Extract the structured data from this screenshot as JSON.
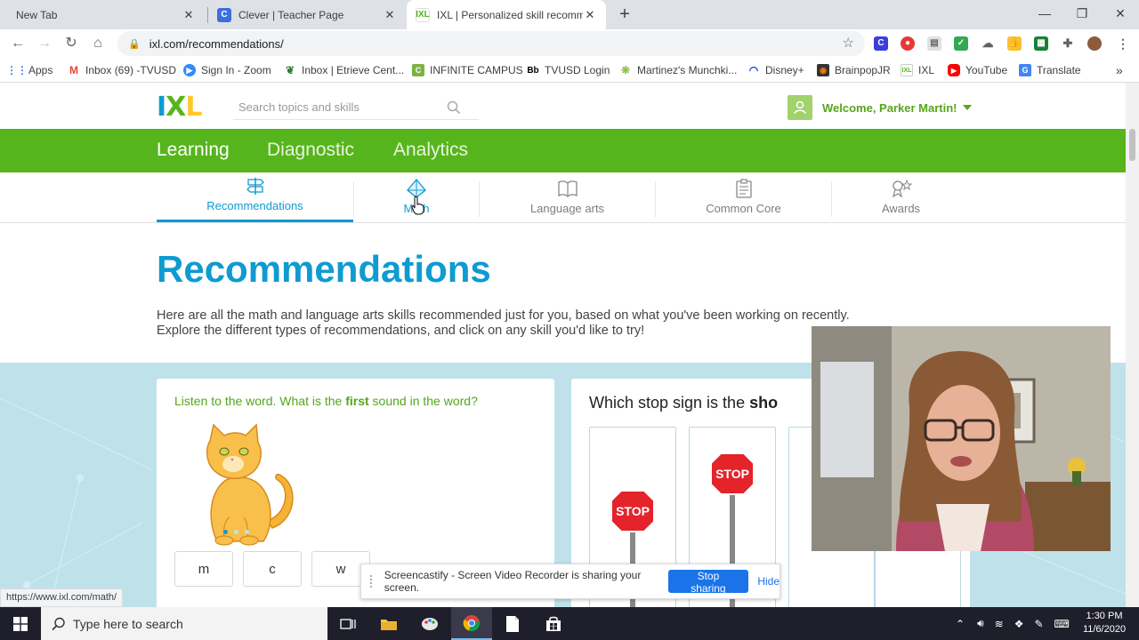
{
  "browser": {
    "tabs": [
      {
        "title": "New Tab"
      },
      {
        "title": "Clever | Teacher Page"
      },
      {
        "title": "IXL | Personalized skill recommen",
        "active": true
      }
    ],
    "url": "ixl.com/recommendations/",
    "bookmarks": [
      {
        "label": "Apps",
        "icon": "apps-grid-icon"
      },
      {
        "label": "Inbox (69) -TVUSD",
        "icon": "gmail-icon"
      },
      {
        "label": "Sign In - Zoom",
        "icon": "zoom-icon"
      },
      {
        "label": "Inbox | Etrieve Cent...",
        "icon": "etrieve-leaf-icon"
      },
      {
        "label": "INFINITE CAMPUS",
        "icon": "infinite-campus-icon"
      },
      {
        "label": "TVUSD Login",
        "icon": "blackboard-icon"
      },
      {
        "label": "Martinez's Munchki...",
        "icon": "munchkins-icon"
      },
      {
        "label": "Disney+",
        "icon": "disney-icon"
      },
      {
        "label": "BrainpopJR",
        "icon": "brainpop-icon"
      },
      {
        "label": "IXL",
        "icon": "ixl-icon"
      },
      {
        "label": "YouTube",
        "icon": "youtube-icon"
      },
      {
        "label": "Translate",
        "icon": "translate-icon"
      }
    ],
    "bookmarks_overflow": "»",
    "status_url": "https://www.ixl.com/math/"
  },
  "ixl": {
    "logo": {
      "I": "I",
      "X": "X",
      "L": "L"
    },
    "search_placeholder": "Search topics and skills",
    "welcome": "Welcome, Parker Martin!",
    "main_nav": [
      "Learning",
      "Diagnostic",
      "Analytics"
    ],
    "sub_nav": [
      "Recommendations",
      "Math",
      "Language arts",
      "Common Core",
      "Awards"
    ],
    "page_title": "Recommendations",
    "description_line1": "Here are all the math and language arts skills recommended just for you, based on what you've been working on recently.",
    "description_line2": "Explore the different types of recommendations, and click on any skill you'd like to try!",
    "card1": {
      "question_pre": "Listen to the word. What is the ",
      "question_bold": "first",
      "question_post": " sound in the word?",
      "choices": [
        "m",
        "c",
        "w"
      ]
    },
    "card2": {
      "question_pre": "Which stop sign is the ",
      "question_bold": "sho"
    },
    "stop_label": "STOP"
  },
  "screencastify": {
    "message": "Screencastify - Screen Video Recorder is sharing your screen.",
    "stop_label": "Stop sharing",
    "hide_label": "Hide"
  },
  "taskbar": {
    "search_placeholder": "Type here to search",
    "time": "1:30 PM",
    "date": "11/6/2020"
  },
  "colors": {
    "ixl_green": "#56b51c",
    "ixl_blue": "#0e9bd1",
    "practice_bg": "#bfe2ea"
  }
}
